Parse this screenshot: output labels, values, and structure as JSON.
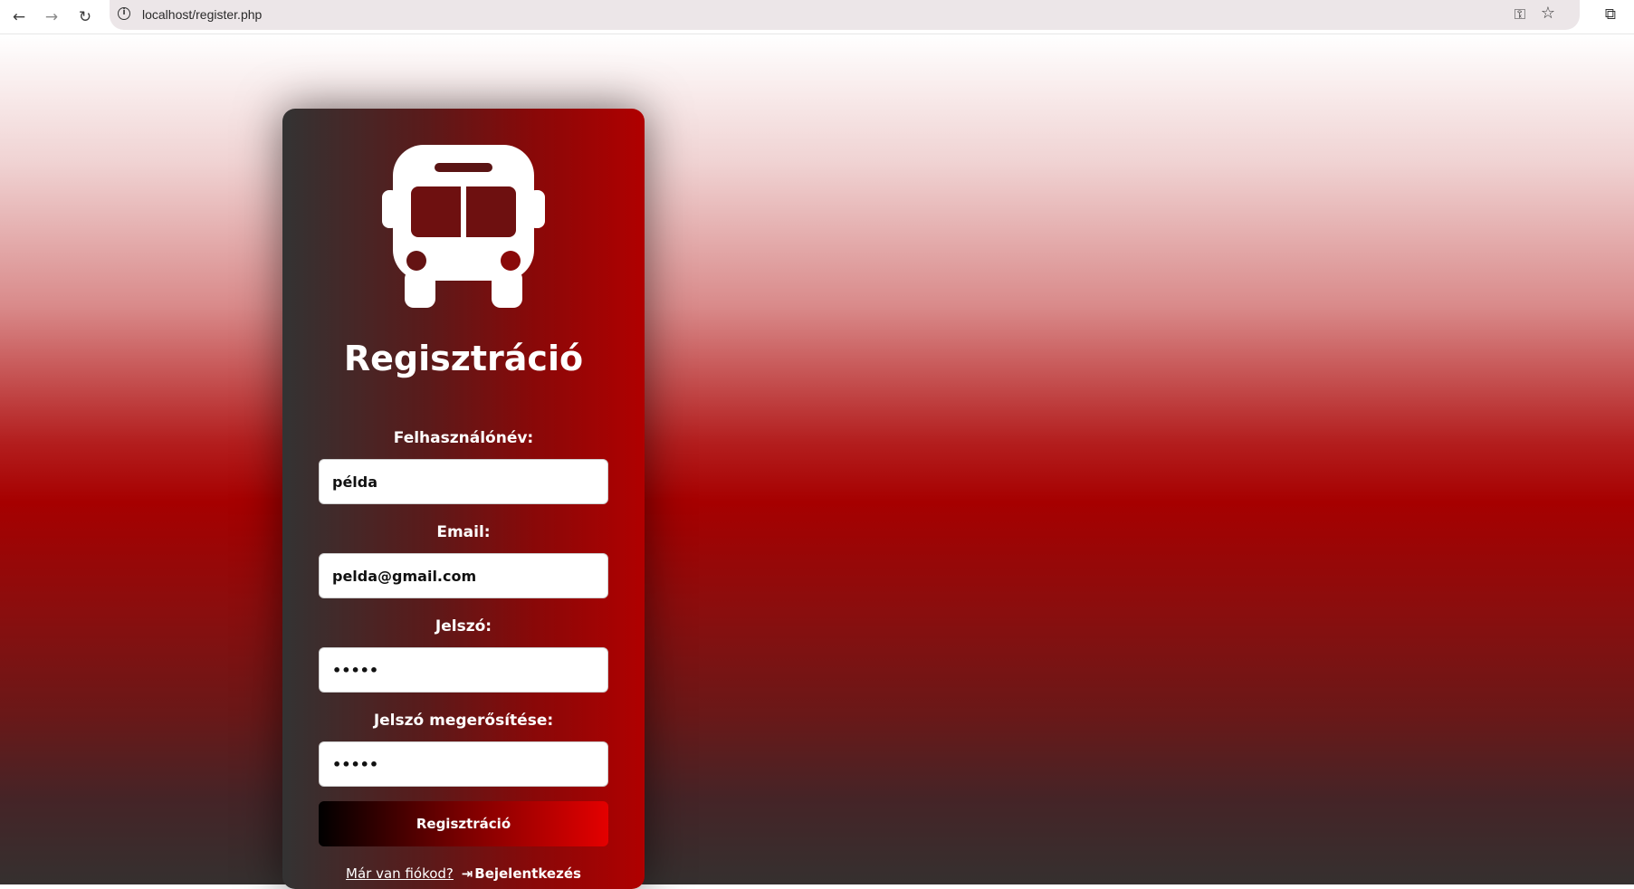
{
  "browser": {
    "url": "localhost/register.php",
    "icons": [
      "back-arrow-icon",
      "forward-arrow-icon",
      "reload-icon",
      "site-info-icon",
      "password-key-icon",
      "bookmark-star-icon",
      "extensions-icon"
    ]
  },
  "form": {
    "title": "Regisztráció",
    "username": {
      "label": "Felhasználónév:",
      "value": "példa"
    },
    "email": {
      "label": "Email:",
      "value": "pelda@gmail.com"
    },
    "password": {
      "label": "Jelszó:",
      "value": "•••••"
    },
    "confirm": {
      "label": "Jelszó megerősítése:",
      "value": "•••••"
    },
    "submit_label": "Regisztráció",
    "footer_question": "Már van fiókod?",
    "login_label": "Bejelentkezés",
    "logo_icon": "bus-icon"
  },
  "colors": {
    "card_left": "#333333",
    "card_right": "#b00000",
    "accent_red": "#a60000",
    "button_start": "#000000",
    "button_end": "#e40000"
  }
}
